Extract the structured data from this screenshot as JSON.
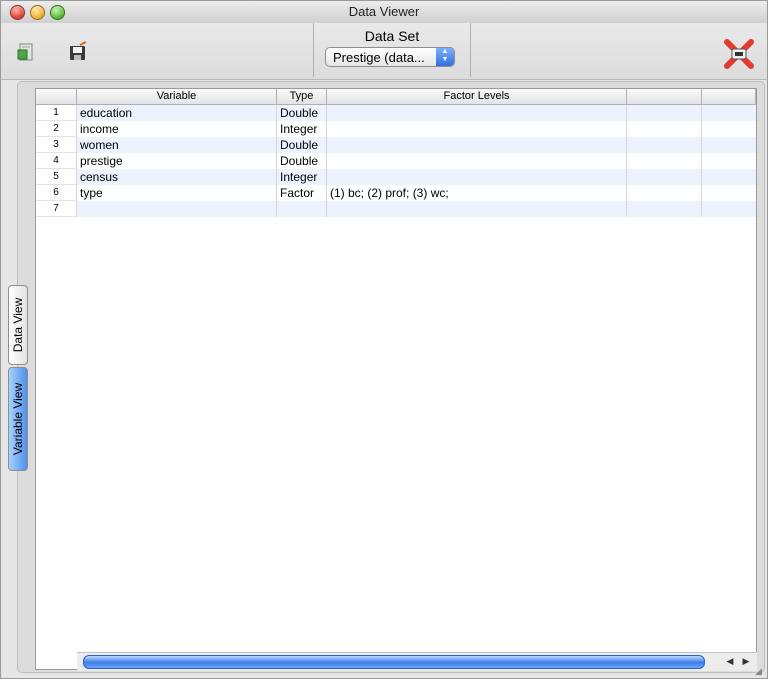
{
  "window": {
    "title": "Data Viewer"
  },
  "toolbar": {
    "dataset_label": "Data Set",
    "dataset_value": "Prestige  (data...",
    "icons": [
      "import-icon",
      "save-icon",
      "close-icon"
    ]
  },
  "table": {
    "columns": [
      "Variable",
      "Type",
      "Factor Levels",
      "",
      ""
    ],
    "rows": [
      {
        "num": "1",
        "variable": "education",
        "type": "Double",
        "levels": ""
      },
      {
        "num": "2",
        "variable": "income",
        "type": "Integer",
        "levels": ""
      },
      {
        "num": "3",
        "variable": "women",
        "type": "Double",
        "levels": ""
      },
      {
        "num": "4",
        "variable": "prestige",
        "type": "Double",
        "levels": ""
      },
      {
        "num": "5",
        "variable": "census",
        "type": "Integer",
        "levels": ""
      },
      {
        "num": "6",
        "variable": "type",
        "type": "Factor",
        "levels": "(1) bc; (2) prof; (3) wc;"
      },
      {
        "num": "7",
        "variable": "",
        "type": "",
        "levels": ""
      }
    ]
  },
  "tabs": {
    "data_view": "Data View",
    "variable_view": "Variable View"
  },
  "colors": {
    "accent": "#3c7de6",
    "row_alt": "#edf3fe"
  }
}
